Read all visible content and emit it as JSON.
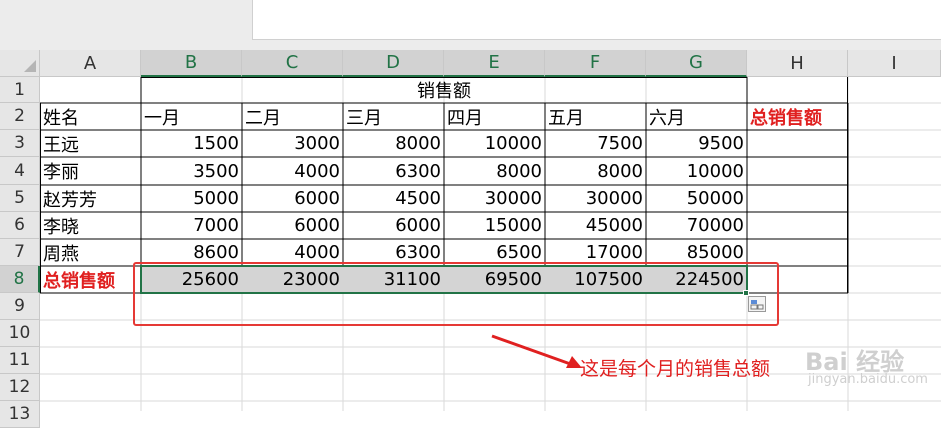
{
  "columns": [
    "A",
    "B",
    "C",
    "D",
    "E",
    "F",
    "G",
    "H",
    "I"
  ],
  "rows": [
    "1",
    "2",
    "3",
    "4",
    "5",
    "6",
    "7",
    "8",
    "9",
    "10",
    "11",
    "12",
    "13"
  ],
  "sheet": {
    "title": "销售额",
    "header": [
      "姓名",
      "一月",
      "二月",
      "三月",
      "四月",
      "五月",
      "六月",
      "总销售额"
    ],
    "data": [
      [
        "王远",
        "1500",
        "3000",
        "8000",
        "10000",
        "7500",
        "9500"
      ],
      [
        "李丽",
        "3500",
        "4000",
        "6300",
        "8000",
        "8000",
        "10000"
      ],
      [
        "赵芳芳",
        "5000",
        "6000",
        "4500",
        "30000",
        "30000",
        "50000"
      ],
      [
        "李晓",
        "7000",
        "6000",
        "6000",
        "15000",
        "45000",
        "70000"
      ],
      [
        "周燕",
        "8600",
        "4000",
        "6300",
        "6500",
        "17000",
        "85000"
      ]
    ],
    "total": [
      "总销售额",
      "25600",
      "23000",
      "31100",
      "69500",
      "107500",
      "224500"
    ]
  },
  "annotation": "这是每个月的销售总额",
  "watermark": {
    "main": "Bai 经验",
    "sub": "jingyan.baidu.com"
  },
  "colors": {
    "accent_green": "#217346",
    "highlight_red": "#e53935",
    "selection_gray": "#d4d4d4"
  }
}
